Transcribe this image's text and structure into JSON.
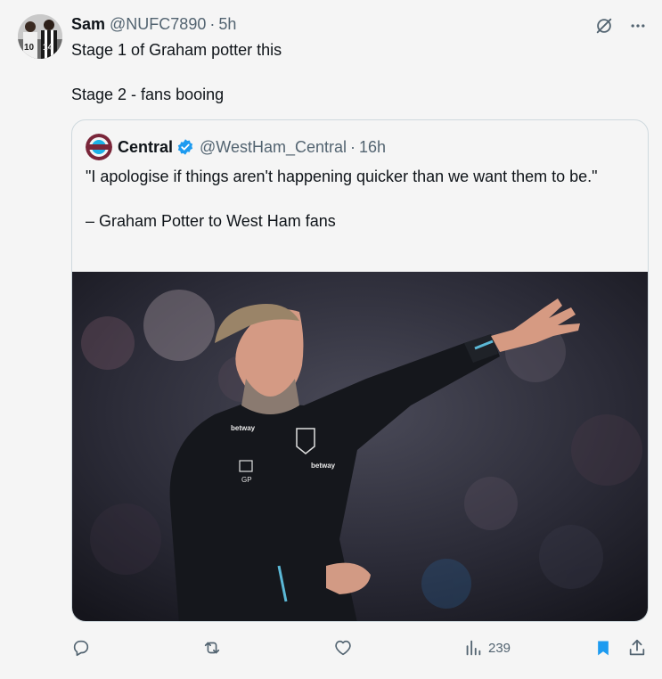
{
  "tweet": {
    "author_name": "Sam",
    "author_handle": "@NUFC7890",
    "separator": "·",
    "time": "5h",
    "text_line1": "Stage 1 of Graham potter this",
    "text_line2": "Stage 2 - fans booing"
  },
  "quote": {
    "author_name": "Central",
    "author_handle": "@WestHam_Central",
    "separator": "·",
    "time": "16h",
    "quote_text": "\"I apologise if things aren't happening quicker than we want them to be.\"",
    "attribution": "– Graham Potter to West Ham fans",
    "photo_sponsor": "betway",
    "photo_initials": "GP"
  },
  "actions": {
    "views_count": "239"
  },
  "colors": {
    "accent": "#1d9bf0",
    "muted": "#536471",
    "background": "#f5f5f5"
  },
  "icons": {
    "top": [
      "grok-icon",
      "more-icon"
    ],
    "actions": [
      "reply-icon",
      "retweet-icon",
      "like-icon",
      "views-icon",
      "bookmark-icon",
      "share-icon"
    ]
  }
}
